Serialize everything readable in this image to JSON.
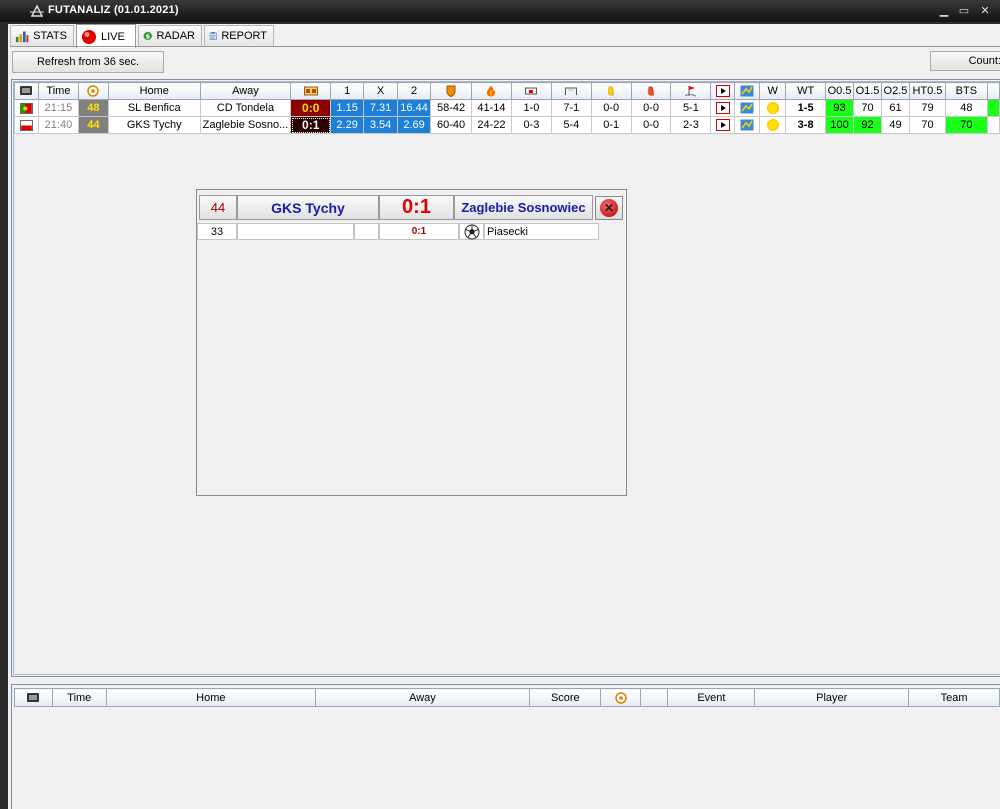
{
  "window": {
    "title": "FUTANALIZ (01.01.2021)"
  },
  "tabs": [
    {
      "label": "STATS",
      "icon": "bar-chart-icon"
    },
    {
      "label": "LIVE",
      "icon": "red-dot-icon",
      "active": true
    },
    {
      "label": "RADAR",
      "icon": "dollar-icon"
    },
    {
      "label": "REPORT",
      "icon": "clipboard-icon"
    }
  ],
  "toolbar": {
    "refresh_label": "Refresh from 36 sec.",
    "count_label": "Count:"
  },
  "grid": {
    "headers": {
      "time": "Time",
      "home": "Home",
      "away": "Away",
      "h1": "1",
      "hx": "X",
      "h2": "2",
      "w": "W",
      "wt": "WT",
      "o05": "O0.5",
      "o15": "O1.5",
      "o25": "O2.5",
      "ht05": "HT0.5",
      "bts": "BTS"
    },
    "rows": [
      {
        "flag": "portugal-flag-icon",
        "time": "21:15",
        "minute": "48",
        "home": "SL Benfica",
        "away": "CD Tondela",
        "score": "0:0",
        "odd1": "1.15",
        "oddx": "7.31",
        "odd2": "16.44",
        "c1": "58-42",
        "c2": "41-14",
        "c3": "1-0",
        "c4": "7-1",
        "c5": "0-0",
        "c6": "0-0",
        "c7": "5-1",
        "wt": "1-5",
        "o05": "93",
        "o15": "70",
        "o25": "61",
        "ht05": "79",
        "bts": "48"
      },
      {
        "flag": "poland-flag-icon",
        "time": "21:40",
        "minute": "44",
        "home": "GKS Tychy",
        "away": "Zaglebie Sosno...",
        "score": "0:1",
        "odd1": "2.29",
        "oddx": "3.54",
        "odd2": "2.69",
        "c1": "60-40",
        "c2": "24-22",
        "c3": "0-3",
        "c4": "5-4",
        "c5": "0-1",
        "c6": "0-0",
        "c7": "2-3",
        "wt": "3-8",
        "o05": "100",
        "o15": "92",
        "o25": "49",
        "ht05": "70",
        "bts": "70"
      }
    ]
  },
  "popup": {
    "minute": "44",
    "home": "GKS Tychy",
    "score": "0:1",
    "away": "Zaglebie Sosnowiec",
    "events": [
      {
        "minute": "33",
        "home_player": "",
        "home_icon": "",
        "score": "0:1",
        "away_icon": "football-icon",
        "away_player": "Piasecki"
      }
    ]
  },
  "events_grid": {
    "headers": {
      "time": "Time",
      "home": "Home",
      "away": "Away",
      "score": "Score",
      "event": "Event",
      "player": "Player",
      "team": "Team"
    }
  },
  "colors": {
    "odds_blue": "#1e7fd6",
    "score_red": "#8b0000",
    "minute_gray": "#808080",
    "green": "#1aff1a",
    "team_blue": "#1a1aa8",
    "score_popup": "#e00000"
  }
}
